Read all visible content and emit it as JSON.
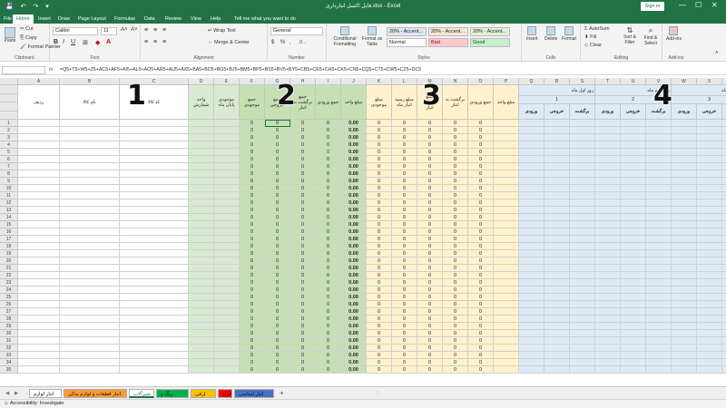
{
  "window": {
    "title": "فایل اکسل انبارداری.xlsx  -  Excel",
    "signin": "Sign in",
    "minimize": "—",
    "maximize": "☐",
    "close": "✕",
    "quick_access": "💾 ↶ ↷ ▾"
  },
  "ribbon_tabs": [
    "File",
    "Home",
    "Insert",
    "Draw",
    "Page Layout",
    "Formulas",
    "Data",
    "Review",
    "View",
    "Help",
    "Tell me what you want to do"
  ],
  "ribbon": {
    "clipboard": {
      "label": "Clipboard",
      "paste": "Paste",
      "cut": "Cut",
      "copy": "Copy",
      "format_painter": "Format Painter"
    },
    "font": {
      "label": "Font",
      "name": "Calibri",
      "size": "11",
      "bold": "B",
      "italic": "I",
      "underline": "U"
    },
    "alignment": {
      "label": "Alignment",
      "wrap": "Wrap Text",
      "merge": "Merge & Center"
    },
    "number": {
      "label": "Number",
      "format": "General",
      "percent": "%",
      "comma": ","
    },
    "styles": {
      "label": "Styles",
      "cond": "Conditional Formatting",
      "table": "Format as Table",
      "cells": [
        "20% - Accent...",
        "20% - Accent...",
        "20% - Accent...",
        "Normal",
        "Bad",
        "Good"
      ]
    },
    "cells": {
      "label": "Cells",
      "insert": "Insert",
      "delete": "Delete",
      "format": "Format"
    },
    "editing": {
      "label": "Editing",
      "autosum": "AutoSum",
      "fill": "Fill",
      "clear": "Clear",
      "sort": "Sort & Filter",
      "find": "Find & Select"
    },
    "addins": {
      "label": "Add-ins",
      "addins": "Add-ins"
    }
  },
  "formula_bar": {
    "fx": "fx",
    "formula": "=Q5+T5+W5+Z5+AC5+AF5+AI5+AL5+AO5+AR5+AU5+AX5+BA5+BD5+BG5+BJ5+BM5+BP5+BS5+BV5+BY5+CB5+CE5+CH5+CK5+CN5+CQ5+CT5+CW5+CZ5+DC5"
  },
  "columns": [
    "A",
    "B",
    "C",
    "D",
    "E",
    "F",
    "G",
    "H",
    "I",
    "J",
    "K",
    "L",
    "M",
    "N",
    "O",
    "P",
    "Q",
    "R",
    "S",
    "T",
    "U",
    "V",
    "W",
    "X",
    "Y",
    "Z",
    "AA"
  ],
  "headers": {
    "radif": "ردیف",
    "kala_name": "نام کالا",
    "kala_code": "کد کالا",
    "unit": "واحد شمارش",
    "end_stock": "موجودی پایان ماه",
    "stock": "جمع موجودی",
    "out_total": "جمع خروجی",
    "return_total": "جمع برگشت به انبار",
    "in_total": "جمع ورودی",
    "amount": "مبلغ واحد",
    "stock_amount": "مبلغ موجودی",
    "in_amount": "مبلغ رسید انبار ماه",
    "out_amount": "مبلغ خروجی انبار",
    "return_amount": "برگشت به انبار",
    "day_in": "ورودی",
    "day_out": "خروجی",
    "day_ret": "برگشت"
  },
  "day_groups": [
    {
      "label": "روز اول ماه",
      "num": "1"
    },
    {
      "label": "روز دوم ماه",
      "num": "2"
    },
    {
      "label": "روز سوم ماه",
      "num": "3"
    },
    {
      "label": "روز چهارم ماه",
      "num": "4"
    }
  ],
  "annotations": [
    "1",
    "2",
    "3",
    "4"
  ],
  "zero": "0",
  "zero_decimal": "0.00",
  "sheet_tabs": [
    "انبار لوازم یدکی",
    "انبار قطعات و لوازم یدکی",
    "شیرآلات",
    "رنگ و چسب",
    "ارقی انبار",
    "ابزار",
    "انبار اساسی"
  ],
  "sheet_tab_colors": [
    "#ffffff",
    "#ff9933",
    "#ffffff",
    "#00b050",
    "#ffc000",
    "#ff0000",
    "#4472c4"
  ],
  "add_sheet": "+",
  "status": {
    "accessibility": "Accessibility: Investigate"
  }
}
